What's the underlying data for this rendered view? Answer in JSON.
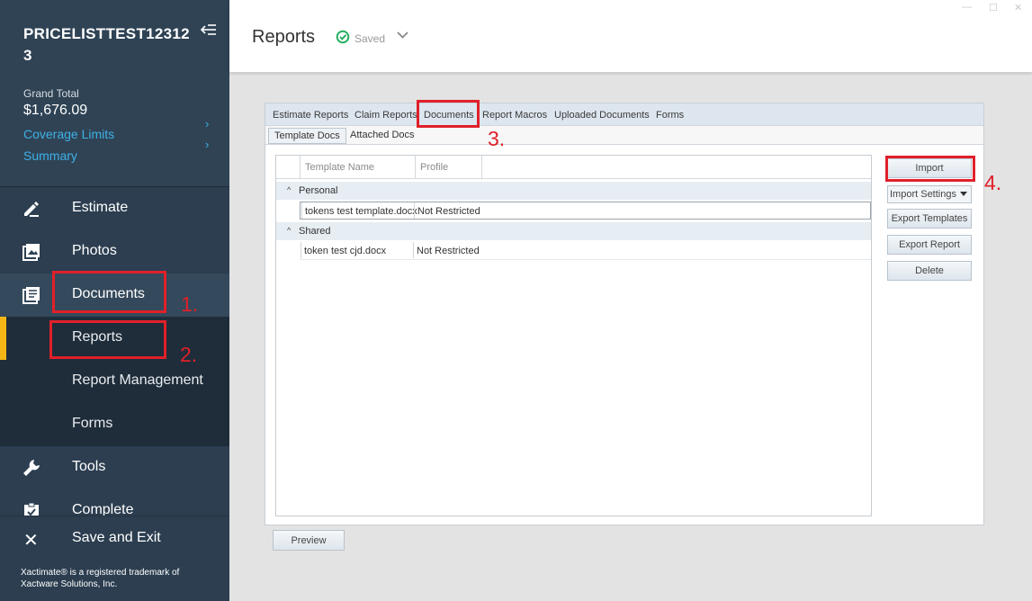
{
  "project": {
    "title": "PRICELISTTEST123123",
    "grand_total_label": "Grand Total",
    "grand_total_value": "$1,676.09",
    "links": [
      {
        "label": "Coverage Limits"
      },
      {
        "label": "Summary"
      }
    ]
  },
  "nav": {
    "estimate": "Estimate",
    "photos": "Photos",
    "documents": "Documents",
    "reports": "Reports",
    "report_management": "Report Management",
    "forms": "Forms",
    "tools": "Tools",
    "complete": "Complete",
    "save_exit": "Save and Exit"
  },
  "footer": {
    "trademark": "Xactimate® is a registered trademark of Xactware Solutions, Inc."
  },
  "header": {
    "title": "Reports",
    "status": "Saved",
    "window_controls": [
      "—",
      "☐",
      "✕"
    ]
  },
  "tabs": [
    "Estimate Reports",
    "Claim Reports",
    "Documents",
    "Report Macros",
    "Uploaded Documents",
    "Forms"
  ],
  "subtabs": [
    "Template Docs",
    "Attached Docs"
  ],
  "grid": {
    "columns": [
      "Template Name",
      "Profile"
    ],
    "groups": [
      {
        "name": "Personal",
        "rows": [
          {
            "name": "tokens test template.docx",
            "profile": "Not Restricted"
          }
        ]
      },
      {
        "name": "Shared",
        "rows": [
          {
            "name": "token test cjd.docx",
            "profile": "Not Restricted"
          }
        ]
      }
    ]
  },
  "actions": {
    "import": "Import",
    "import_settings": "Import Settings",
    "export_templates": "Export Templates",
    "export_report": "Export Report",
    "delete": "Delete",
    "preview": "Preview"
  },
  "annotations": {
    "step1": "1.",
    "step2": "2.",
    "step3": "3.",
    "step4": "4."
  },
  "colors": {
    "sidebar": "#2c3e50",
    "accent": "#f5b515",
    "link": "#3fb1e5",
    "highlight": "#e0202a",
    "saved": "#27ae60"
  }
}
